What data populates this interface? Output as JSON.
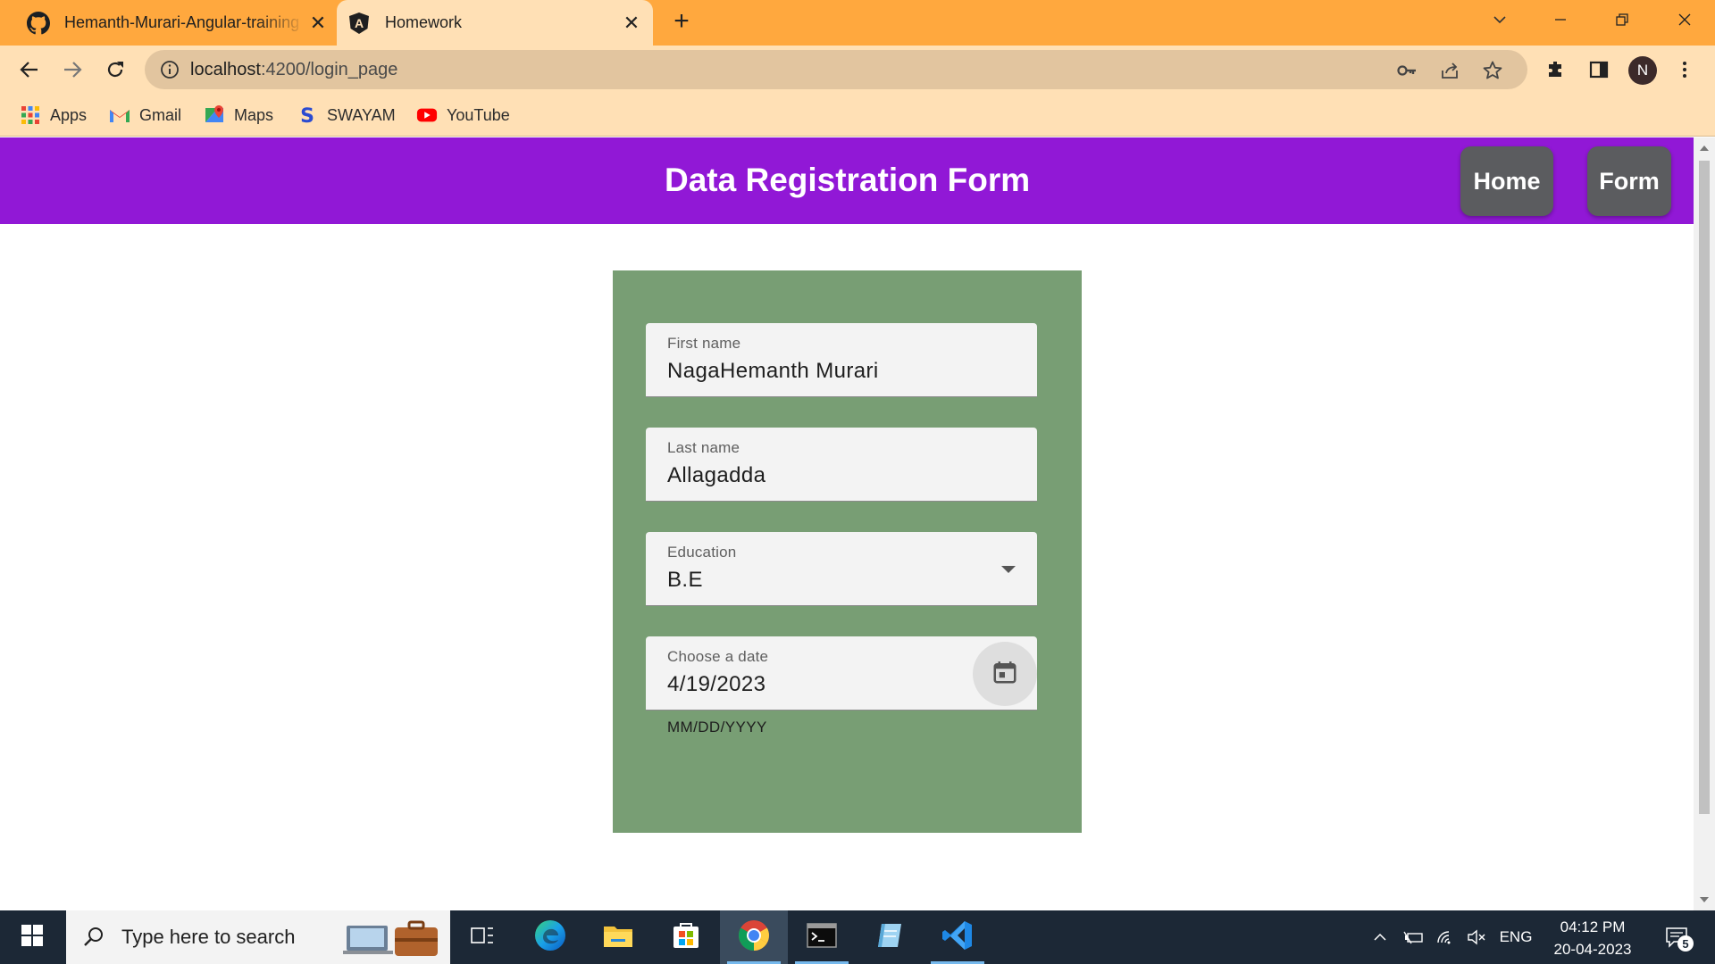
{
  "browser": {
    "tabs": [
      {
        "title": "Hemanth-Murari-Angular-training",
        "active": false,
        "icon": "github-icon"
      },
      {
        "title": "Homework",
        "active": true,
        "icon": "angular-icon"
      }
    ],
    "url_host": "localhost",
    "url_path": ":4200/login_page",
    "profile_initial": "N",
    "bookmarks": [
      {
        "label": "Apps",
        "icon": "apps-grid-icon"
      },
      {
        "label": "Gmail",
        "icon": "gmail-icon"
      },
      {
        "label": "Maps",
        "icon": "maps-icon"
      },
      {
        "label": "SWAYAM",
        "icon": "swayam-icon"
      },
      {
        "label": "YouTube",
        "icon": "youtube-icon"
      }
    ]
  },
  "app": {
    "title": "Data Registration Form",
    "nav": {
      "home": "Home",
      "form": "Form"
    },
    "colors": {
      "appbar": "#9118d6",
      "card": "#789e74",
      "nav_button": "#5b5c5f"
    }
  },
  "form": {
    "first_name": {
      "label": "First name",
      "value": "NagaHemanth Murari"
    },
    "last_name": {
      "label": "Last name",
      "value": "Allagadda"
    },
    "education": {
      "label": "Education",
      "value": "B.E"
    },
    "date": {
      "label": "Choose a date",
      "value": "4/19/2023",
      "hint": "MM/DD/YYYY"
    }
  },
  "taskbar": {
    "search_placeholder": "Type here to search",
    "language": "ENG",
    "time": "04:12 PM",
    "date": "20-04-2023",
    "notification_count": "5"
  }
}
